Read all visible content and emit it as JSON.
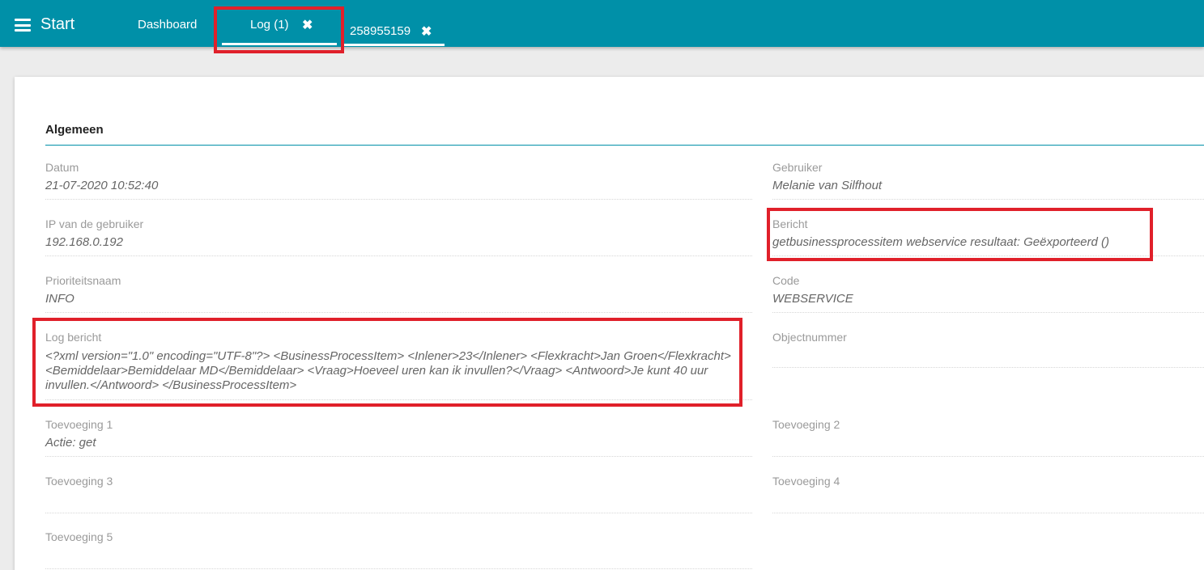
{
  "header": {
    "menu_label": "Start",
    "tabs": [
      {
        "label": "Dashboard"
      },
      {
        "label": "Log (1)"
      },
      {
        "label": "258955159"
      }
    ],
    "close_glyph": "✖"
  },
  "section": {
    "title": "Algemeen"
  },
  "fields": {
    "datum": {
      "label": "Datum",
      "value": "21-07-2020 10:52:40"
    },
    "gebruiker": {
      "label": "Gebruiker",
      "value": "Melanie van Silfhout"
    },
    "ip": {
      "label": "IP van de gebruiker",
      "value": "192.168.0.192"
    },
    "bericht": {
      "label": "Bericht",
      "value": "getbusinessprocessitem webservice resultaat: Geëxporteerd ()"
    },
    "prioriteit": {
      "label": "Prioriteitsnaam",
      "value": "INFO"
    },
    "code": {
      "label": "Code",
      "value": "WEBSERVICE"
    },
    "logbericht": {
      "label": "Log bericht",
      "value": "<?xml version=\"1.0\" encoding=\"UTF-8\"?> <BusinessProcessItem> <Inlener>23</Inlener> <Flexkracht>Jan Groen</Flexkracht> <Bemiddelaar>Bemiddelaar MD</Bemiddelaar> <Vraag>Hoeveel uren kan ik invullen?</Vraag> <Antwoord>Je kunt 40 uur invullen.</Antwoord> </BusinessProcessItem>"
    },
    "objectnummer": {
      "label": "Objectnummer",
      "value": ""
    },
    "toevoeging1": {
      "label": "Toevoeging 1",
      "value": "Actie: get"
    },
    "toevoeging2": {
      "label": "Toevoeging 2",
      "value": ""
    },
    "toevoeging3": {
      "label": "Toevoeging 3",
      "value": ""
    },
    "toevoeging4": {
      "label": "Toevoeging 4",
      "value": ""
    },
    "toevoeging5": {
      "label": "Toevoeging 5",
      "value": ""
    }
  },
  "icons": {
    "menu": "hamburger-icon",
    "close": "close-icon"
  },
  "colors": {
    "header_bg": "#0090a8",
    "highlight": "#e0202a",
    "page_bg": "#ececec"
  }
}
